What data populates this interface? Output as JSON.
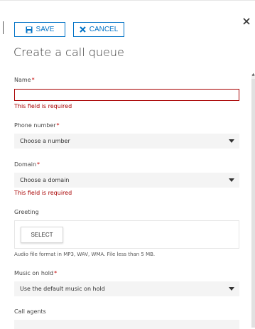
{
  "toolbar": {
    "save_label": "SAVE",
    "cancel_label": "CANCEL"
  },
  "page": {
    "title": "Create a call queue"
  },
  "form": {
    "name": {
      "label": "Name",
      "required_marker": "*",
      "value": "",
      "error": "This field is required"
    },
    "phone_number": {
      "label": "Phone number",
      "required_marker": "*",
      "selected": "Choose a number"
    },
    "domain": {
      "label": "Domain",
      "required_marker": "*",
      "selected": "Choose a domain",
      "error": "This field is required"
    },
    "greeting": {
      "label": "Greeting",
      "button_label": "SELECT",
      "hint": "Audio file format in MP3, WAV, WMA. File less than 5 MB."
    },
    "music_on_hold": {
      "label": "Music on hold",
      "required_marker": "*",
      "selected": "Use the default music on hold"
    },
    "call_agents": {
      "label": "Call agents"
    }
  },
  "icons": {
    "save": "save-icon",
    "cancel": "cancel-icon",
    "close": "close-icon",
    "dropdown": "chevron-down-icon"
  },
  "colors": {
    "accent": "#0072c6",
    "error": "#a80000",
    "required": "#c40000",
    "field_background": "#f4f4f4",
    "text": "#333333"
  }
}
